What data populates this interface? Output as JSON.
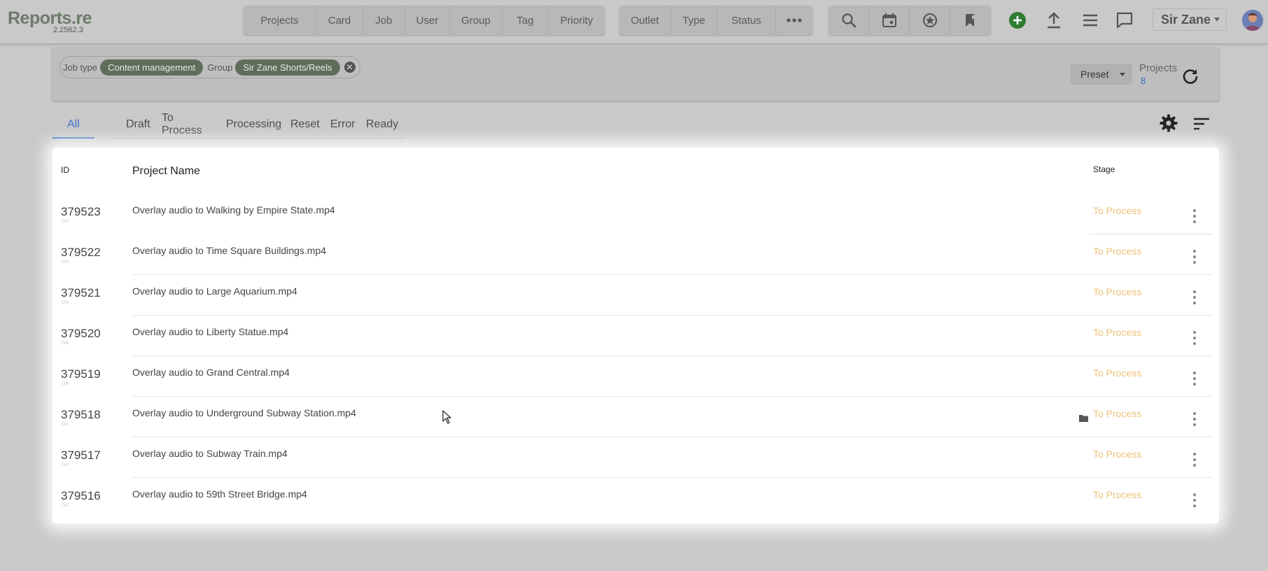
{
  "app": {
    "logo": "Reports.re",
    "version": "2.2562.3"
  },
  "topbar": {
    "group1": [
      "Projects",
      "Card",
      "Job",
      "User",
      "Group",
      "Tag",
      "Priority"
    ],
    "group2": [
      "Outlet",
      "Type",
      "Status"
    ],
    "more_icon": "more-horizontal-icon",
    "tool_icons": [
      "search-icon",
      "calendar-icon",
      "star-badge-icon",
      "bookmark-icon"
    ],
    "action_icons": [
      "add-circle-icon",
      "upload-icon",
      "menu-icon",
      "chat-icon"
    ],
    "user_name": "Sir Zane",
    "add_color": "#2e7d32"
  },
  "filters": {
    "job_type_label": "Job type",
    "job_type_value": "Content management",
    "group_label": "Group",
    "group_value": "Sir Zane Shorts/Reels",
    "clear_symbol": "✕",
    "preset_label": "Preset",
    "projects_label": "Projects",
    "projects_count": "8"
  },
  "tabs": [
    "All",
    "Draft",
    "To Process",
    "Processing",
    "Reset",
    "Error",
    "Ready"
  ],
  "table": {
    "headers": {
      "id": "ID",
      "name": "Project Name",
      "stage": "Stage"
    },
    "rows": [
      {
        "id": "379523",
        "sub": "OA",
        "name": "Overlay audio to Walking by Empire State.mp4",
        "stage": "To Process",
        "folder": false
      },
      {
        "id": "379522",
        "sub": "OA",
        "name": "Overlay audio to Time Square Buildings.mp4",
        "stage": "To Process",
        "folder": false
      },
      {
        "id": "379521",
        "sub": "OA",
        "name": "Overlay audio to Large Aquarium.mp4",
        "stage": "To Process",
        "folder": false
      },
      {
        "id": "379520",
        "sub": "OA",
        "name": "Overlay audio to Liberty Statue.mp4",
        "stage": "To Process",
        "folder": false
      },
      {
        "id": "379519",
        "sub": "OA",
        "name": "Overlay audio to Grand Central.mp4",
        "stage": "To Process",
        "folder": false
      },
      {
        "id": "379518",
        "sub": "OA",
        "name": "Overlay audio to Underground Subway Station.mp4",
        "stage": "To Process",
        "folder": true
      },
      {
        "id": "379517",
        "sub": "OA",
        "name": "Overlay audio to Subway Train.mp4",
        "stage": "To Process",
        "folder": false
      },
      {
        "id": "379516",
        "sub": "OA",
        "name": "Overlay audio to 59th Street Bridge.mp4",
        "stage": "To Process",
        "folder": false
      }
    ],
    "stage_color": "#ecc27a"
  }
}
